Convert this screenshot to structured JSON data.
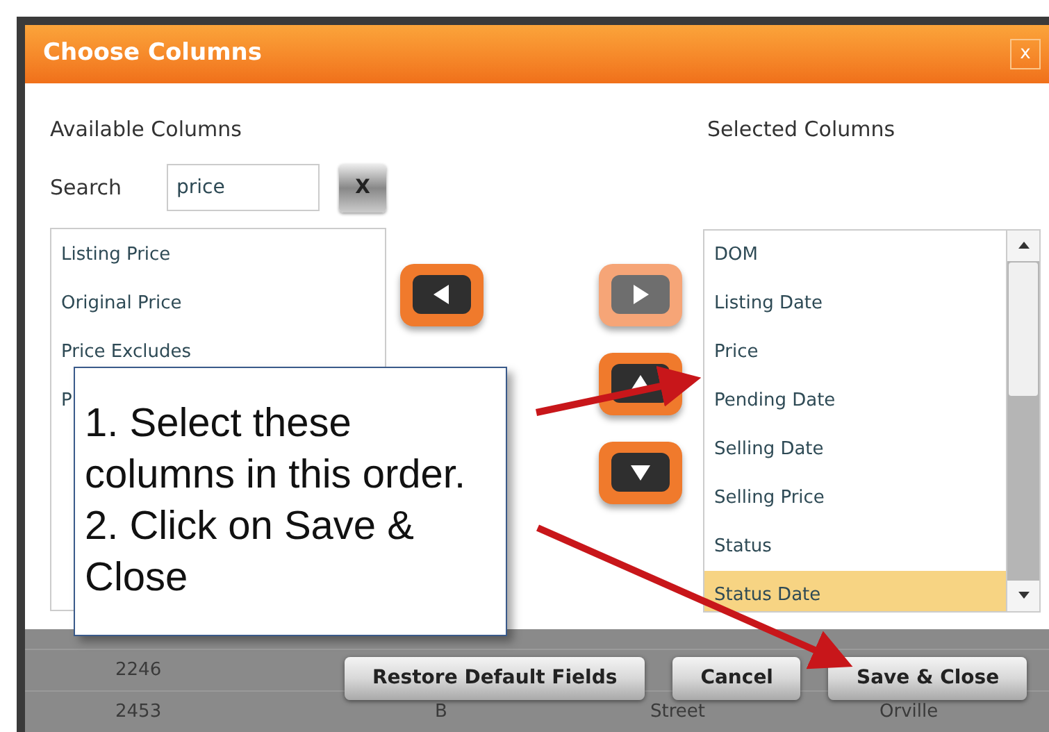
{
  "dialog": {
    "title": "Choose Columns",
    "close_label": "x"
  },
  "available": {
    "heading": "Available Columns",
    "search_label": "Search",
    "search_value": "price",
    "clear_label": "X",
    "items": [
      {
        "label": "Listing Price",
        "selected": false
      },
      {
        "label": "Original Price",
        "selected": false
      },
      {
        "label": "Price Excludes",
        "selected": false
      },
      {
        "label": "P",
        "selected": false
      }
    ]
  },
  "move_buttons": [
    {
      "kind": "left",
      "disabled": false
    },
    {
      "kind": "right",
      "disabled": true
    },
    {
      "kind": "up",
      "disabled": false
    },
    {
      "kind": "down",
      "disabled": false
    }
  ],
  "selected": {
    "heading": "Selected Columns",
    "items": [
      {
        "label": "DOM",
        "selected": false
      },
      {
        "label": "Listing Date",
        "selected": false
      },
      {
        "label": "Price",
        "selected": false
      },
      {
        "label": "Pending Date",
        "selected": false
      },
      {
        "label": "Selling Date",
        "selected": false
      },
      {
        "label": "Selling Price",
        "selected": false
      },
      {
        "label": "Status",
        "selected": false
      },
      {
        "label": "Status Date",
        "selected": true
      }
    ]
  },
  "footer_buttons": [
    "Restore Default Fields",
    "Cancel",
    "Save & Close"
  ],
  "background_table": {
    "rows": [
      [
        "2246"
      ],
      [
        "2453",
        "B",
        "Street",
        "Orville"
      ]
    ]
  },
  "callout": {
    "steps": [
      "1. Select these columns in this order.",
      "2. Click on Save & Close"
    ]
  }
}
